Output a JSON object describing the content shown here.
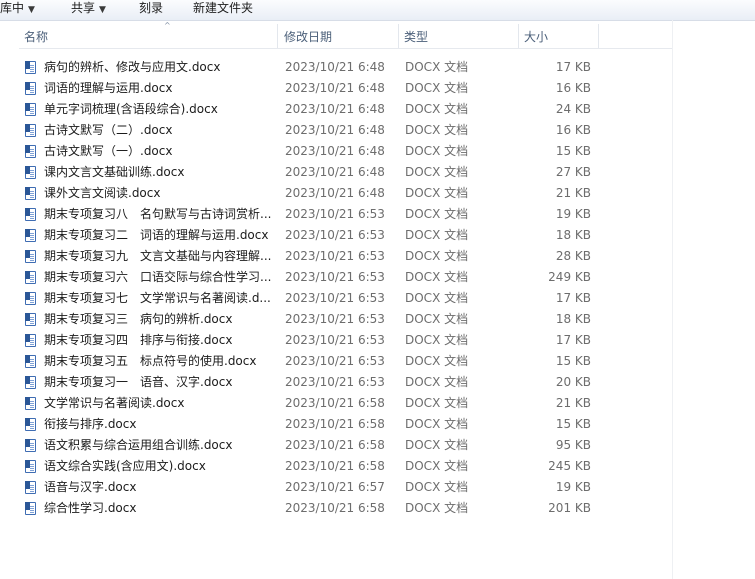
{
  "toolbar": {
    "library": "库中",
    "share": "共享",
    "burn": "刻录",
    "new_folder": "新建文件夹"
  },
  "columns": {
    "name": "名称",
    "modified": "修改日期",
    "type": "类型",
    "size": "大小"
  },
  "files": [
    {
      "name": "病句的辨析、修改与应用文.docx",
      "modified": "2023/10/21 6:48",
      "type": "DOCX 文档",
      "size": "17 KB"
    },
    {
      "name": "词语的理解与运用.docx",
      "modified": "2023/10/21 6:48",
      "type": "DOCX 文档",
      "size": "16 KB"
    },
    {
      "name": "单元字词梳理(含语段综合).docx",
      "modified": "2023/10/21 6:48",
      "type": "DOCX 文档",
      "size": "24 KB"
    },
    {
      "name": "古诗文默写（二）.docx",
      "modified": "2023/10/21 6:48",
      "type": "DOCX 文档",
      "size": "16 KB"
    },
    {
      "name": "古诗文默写（一）.docx",
      "modified": "2023/10/21 6:48",
      "type": "DOCX 文档",
      "size": "15 KB"
    },
    {
      "name": "课内文言文基础训练.docx",
      "modified": "2023/10/21 6:48",
      "type": "DOCX 文档",
      "size": "27 KB"
    },
    {
      "name": "课外文言文阅读.docx",
      "modified": "2023/10/21 6:48",
      "type": "DOCX 文档",
      "size": "21 KB"
    },
    {
      "name": "期末专项复习八　名句默写与古诗词赏析...",
      "modified": "2023/10/21 6:53",
      "type": "DOCX 文档",
      "size": "19 KB"
    },
    {
      "name": "期末专项复习二　词语的理解与运用.docx",
      "modified": "2023/10/21 6:53",
      "type": "DOCX 文档",
      "size": "18 KB"
    },
    {
      "name": "期末专项复习九　文言文基础与内容理解...",
      "modified": "2023/10/21 6:53",
      "type": "DOCX 文档",
      "size": "28 KB"
    },
    {
      "name": "期末专项复习六　口语交际与综合性学习...",
      "modified": "2023/10/21 6:53",
      "type": "DOCX 文档",
      "size": "249 KB"
    },
    {
      "name": "期末专项复习七　文学常识与名著阅读.d...",
      "modified": "2023/10/21 6:53",
      "type": "DOCX 文档",
      "size": "17 KB"
    },
    {
      "name": "期末专项复习三　病句的辨析.docx",
      "modified": "2023/10/21 6:53",
      "type": "DOCX 文档",
      "size": "18 KB"
    },
    {
      "name": "期末专项复习四　排序与衔接.docx",
      "modified": "2023/10/21 6:53",
      "type": "DOCX 文档",
      "size": "17 KB"
    },
    {
      "name": "期末专项复习五　标点符号的使用.docx",
      "modified": "2023/10/21 6:53",
      "type": "DOCX 文档",
      "size": "15 KB"
    },
    {
      "name": "期末专项复习一　语音、汉字.docx",
      "modified": "2023/10/21 6:53",
      "type": "DOCX 文档",
      "size": "20 KB"
    },
    {
      "name": "文学常识与名著阅读.docx",
      "modified": "2023/10/21 6:58",
      "type": "DOCX 文档",
      "size": "21 KB"
    },
    {
      "name": "衔接与排序.docx",
      "modified": "2023/10/21 6:58",
      "type": "DOCX 文档",
      "size": "15 KB"
    },
    {
      "name": "语文积累与综合运用组合训练.docx",
      "modified": "2023/10/21 6:58",
      "type": "DOCX 文档",
      "size": "95 KB"
    },
    {
      "name": "语文综合实践(含应用文).docx",
      "modified": "2023/10/21 6:58",
      "type": "DOCX 文档",
      "size": "245 KB"
    },
    {
      "name": "语音与汉字.docx",
      "modified": "2023/10/21 6:57",
      "type": "DOCX 文档",
      "size": "19 KB"
    },
    {
      "name": "综合性学习.docx",
      "modified": "2023/10/21 6:58",
      "type": "DOCX 文档",
      "size": "201 KB"
    }
  ]
}
